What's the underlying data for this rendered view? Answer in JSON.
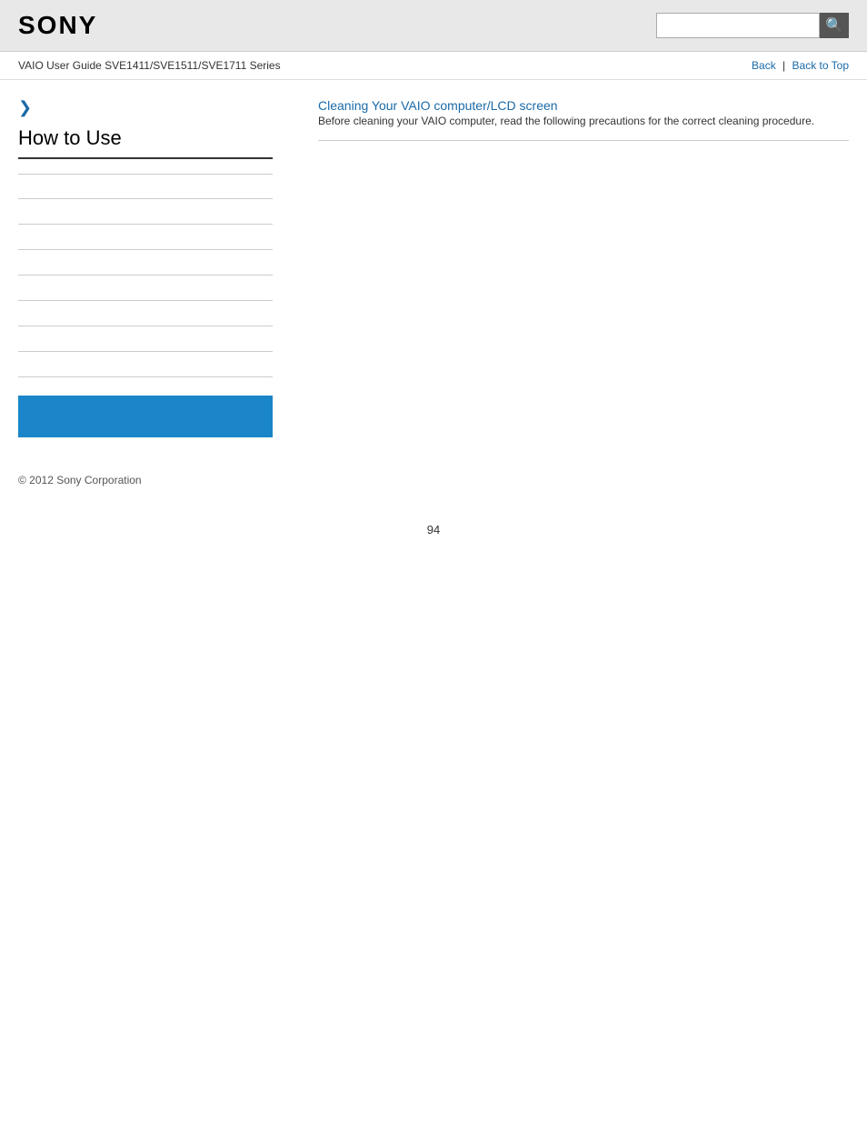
{
  "header": {
    "logo": "SONY",
    "search_placeholder": ""
  },
  "navbar": {
    "breadcrumb": "VAIO User Guide SVE1411/SVE1511/SVE1711 Series",
    "back_label": "Back",
    "back_to_top_label": "Back to Top",
    "separator": "|"
  },
  "sidebar": {
    "arrow": "❯",
    "title": "How to Use",
    "nav_items": [
      {
        "label": ""
      },
      {
        "label": ""
      },
      {
        "label": ""
      },
      {
        "label": ""
      },
      {
        "label": ""
      },
      {
        "label": ""
      },
      {
        "label": ""
      },
      {
        "label": ""
      }
    ],
    "blue_box_label": ""
  },
  "content": {
    "article_title": "Cleaning Your VAIO computer/LCD screen",
    "article_desc": "Before cleaning your VAIO computer, read the following precautions for the correct cleaning procedure."
  },
  "footer": {
    "copyright": "© 2012 Sony Corporation"
  },
  "page_number": "94",
  "colors": {
    "link": "#1a6aa8",
    "blue_box": "#1a85c8"
  }
}
